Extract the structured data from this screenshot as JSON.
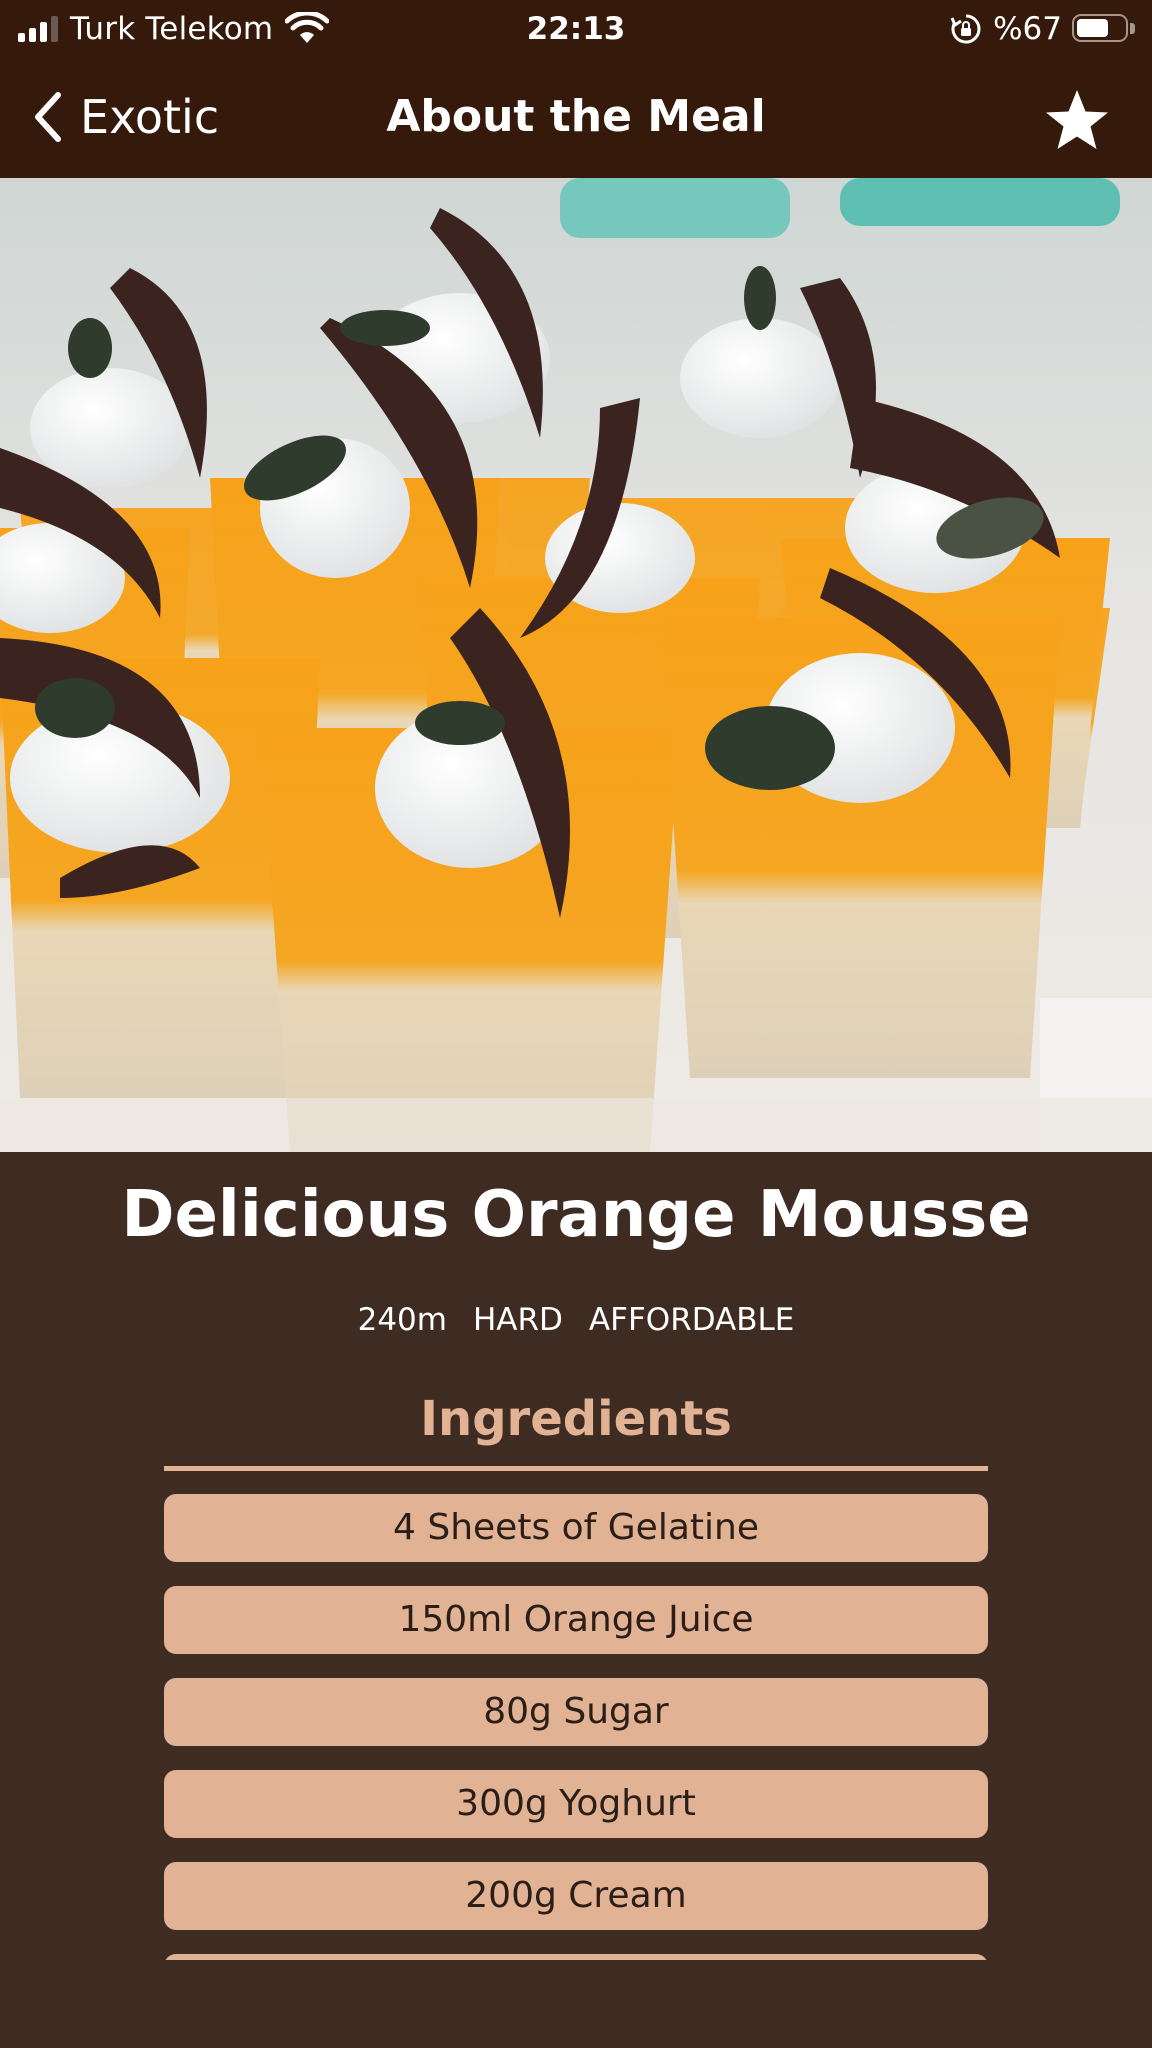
{
  "status_bar": {
    "carrier": "Turk Telekom",
    "time": "22:13",
    "battery_text": "%67",
    "battery_level": 0.67,
    "signal_bars": 3,
    "icons": [
      "signal-icon",
      "wifi-icon",
      "rotation-lock-icon",
      "battery-icon"
    ]
  },
  "nav": {
    "back_label": "Exotic",
    "title": "About the Meal",
    "favorite_icon": "star-icon",
    "back_icon": "chevron-left-icon"
  },
  "meal": {
    "image_description_icon": "meal-photo",
    "title": "Delicious Orange Mousse",
    "duration": "240m",
    "complexity": "HARD",
    "affordability": "AFFORDABLE"
  },
  "ingredients": {
    "title": "Ingredients",
    "items": [
      "4 Sheets of Gelatine",
      "150ml Orange Juice",
      "80g Sugar",
      "300g Yoghurt",
      "200g Cream",
      ""
    ]
  },
  "colors": {
    "header_bg": "#351a0c",
    "page_bg": "#3e2c23",
    "accent": "#e1b294",
    "text_dark": "#2a1e17",
    "text_light": "#ffffff"
  }
}
